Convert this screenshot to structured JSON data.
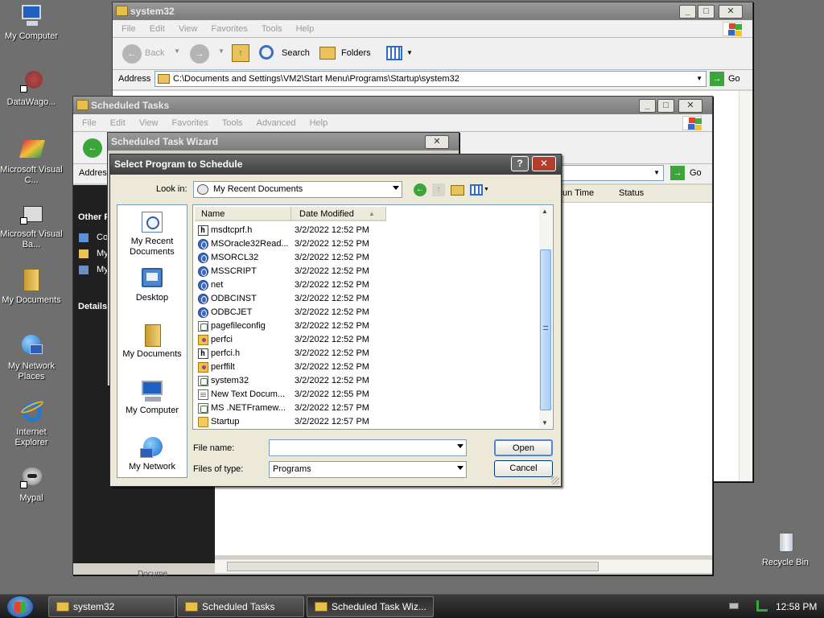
{
  "desktop": {
    "icons": [
      {
        "label": "My Computer"
      },
      {
        "label": "DataWago..."
      },
      {
        "label": "Microsoft Visual C..."
      },
      {
        "label": "Microsoft Visual Ba..."
      },
      {
        "label": "My Documents"
      },
      {
        "label": "My Network Places"
      },
      {
        "label": "Internet Explorer"
      },
      {
        "label": "Mypal"
      },
      {
        "label": "Recycle Bin"
      }
    ]
  },
  "explorer": {
    "title": "system32",
    "menu": [
      "File",
      "Edit",
      "View",
      "Favorites",
      "Tools",
      "Help"
    ],
    "toolbar": {
      "back": "Back",
      "search": "Search",
      "folders": "Folders"
    },
    "address_label": "Address",
    "address_value": "C:\\Documents and Settings\\VM2\\Start Menu\\Programs\\Startup\\system32",
    "go": "Go"
  },
  "tasks": {
    "title": "Scheduled Tasks",
    "menu": [
      "File",
      "Edit",
      "View",
      "Favorites",
      "Tools",
      "Advanced",
      "Help"
    ],
    "address_label": "Addres",
    "go": "Go",
    "columns": [
      "un Time",
      "Status"
    ],
    "side": {
      "other": "Other P",
      "items": [
        "Co",
        "My",
        "My"
      ],
      "details": "Details",
      "docu": "Docume"
    }
  },
  "wizard": {
    "title": "Scheduled Task Wizard"
  },
  "dialog": {
    "title": "Select Program to Schedule",
    "look_in_label": "Look in:",
    "look_in_value": "My Recent Documents",
    "places": [
      "My Recent Documents",
      "Desktop",
      "My Documents",
      "My Computer",
      "My Network"
    ],
    "columns": {
      "name": "Name",
      "date": "Date Modified"
    },
    "files": [
      {
        "name": "msdtcprf.h",
        "date": "3/2/2022 12:52 PM",
        "icon": "h-file-icon"
      },
      {
        "name": "MSOracle32Read...",
        "date": "3/2/2022 12:52 PM",
        "icon": "script-file-icon"
      },
      {
        "name": "MSORCL32",
        "date": "3/2/2022 12:52 PM",
        "icon": "script-file-icon"
      },
      {
        "name": "MSSCRIPT",
        "date": "3/2/2022 12:52 PM",
        "icon": "script-file-icon"
      },
      {
        "name": "net",
        "date": "3/2/2022 12:52 PM",
        "icon": "script-file-icon"
      },
      {
        "name": "ODBCINST",
        "date": "3/2/2022 12:52 PM",
        "icon": "script-file-icon"
      },
      {
        "name": "ODBCJET",
        "date": "3/2/2022 12:52 PM",
        "icon": "script-file-icon"
      },
      {
        "name": "pagefileconfig",
        "date": "3/2/2022 12:52 PM",
        "icon": "config-file-icon"
      },
      {
        "name": "perfci",
        "date": "3/2/2022 12:52 PM",
        "icon": "perf-file-icon"
      },
      {
        "name": "perfci.h",
        "date": "3/2/2022 12:52 PM",
        "icon": "h-file-icon"
      },
      {
        "name": "perffilt",
        "date": "3/2/2022 12:52 PM",
        "icon": "perf-file-icon"
      },
      {
        "name": "system32",
        "date": "3/2/2022 12:52 PM",
        "icon": "config-file-icon"
      },
      {
        "name": "New Text Docum...",
        "date": "3/2/2022 12:55 PM",
        "icon": "text-file-icon"
      },
      {
        "name": "MS .NETFramew...",
        "date": "3/2/2022 12:57 PM",
        "icon": "config-file-icon"
      },
      {
        "name": "Startup",
        "date": "3/2/2022 12:57 PM",
        "icon": "folder-icon"
      }
    ],
    "file_name_label": "File name:",
    "file_name_value": "",
    "files_of_type_label": "Files of type:",
    "files_of_type_value": "Programs",
    "open": "Open",
    "cancel": "Cancel"
  },
  "taskbar": {
    "items": [
      {
        "label": "system32"
      },
      {
        "label": "Scheduled Tasks"
      },
      {
        "label": "Scheduled Task Wiz..."
      }
    ],
    "clock": "12:58 PM"
  }
}
